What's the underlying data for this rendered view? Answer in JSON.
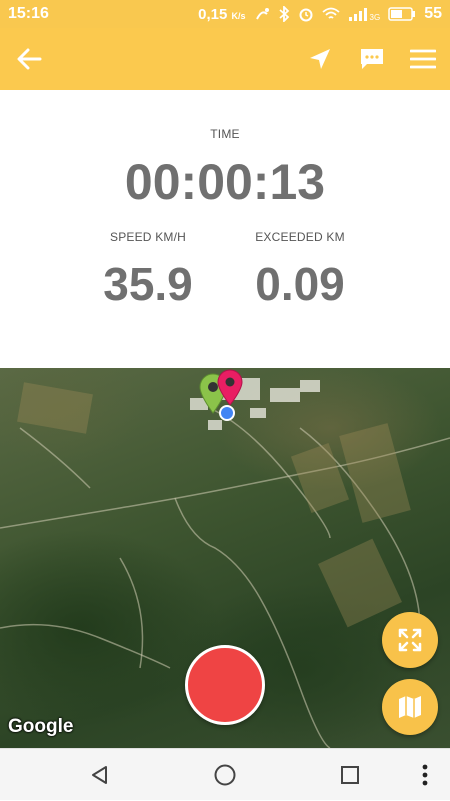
{
  "status_bar": {
    "time": "15:16",
    "net_speed": "0,15",
    "net_unit": "K/s",
    "network_type": "3G",
    "battery": "55",
    "icons": [
      "nfc-icon",
      "bluetooth-icon",
      "alarm-icon",
      "wifi-icon",
      "signal-icon",
      "battery-icon"
    ]
  },
  "toolbar": {
    "back_icon": "arrow-left-icon",
    "actions": [
      "navigation-icon",
      "message-icon",
      "menu-icon"
    ],
    "background": "#fbc94e"
  },
  "stats": {
    "time_label": "TIME",
    "time_value": "00:00:13",
    "speed_label": "SPEED KM/H",
    "speed_value": "35.9",
    "distance_label": "EXCEEDED KM",
    "distance_value": "0.09"
  },
  "map": {
    "attribution": "Google",
    "markers": [
      "green-pin-icon",
      "pink-pin-icon",
      "current-location-dot"
    ],
    "fab_color": "#f8c24a",
    "record_color": "#ef4444"
  },
  "nav_bar": {
    "buttons": [
      "back-triangle-icon",
      "home-circle-icon",
      "recents-square-icon",
      "more-dots-icon"
    ]
  }
}
